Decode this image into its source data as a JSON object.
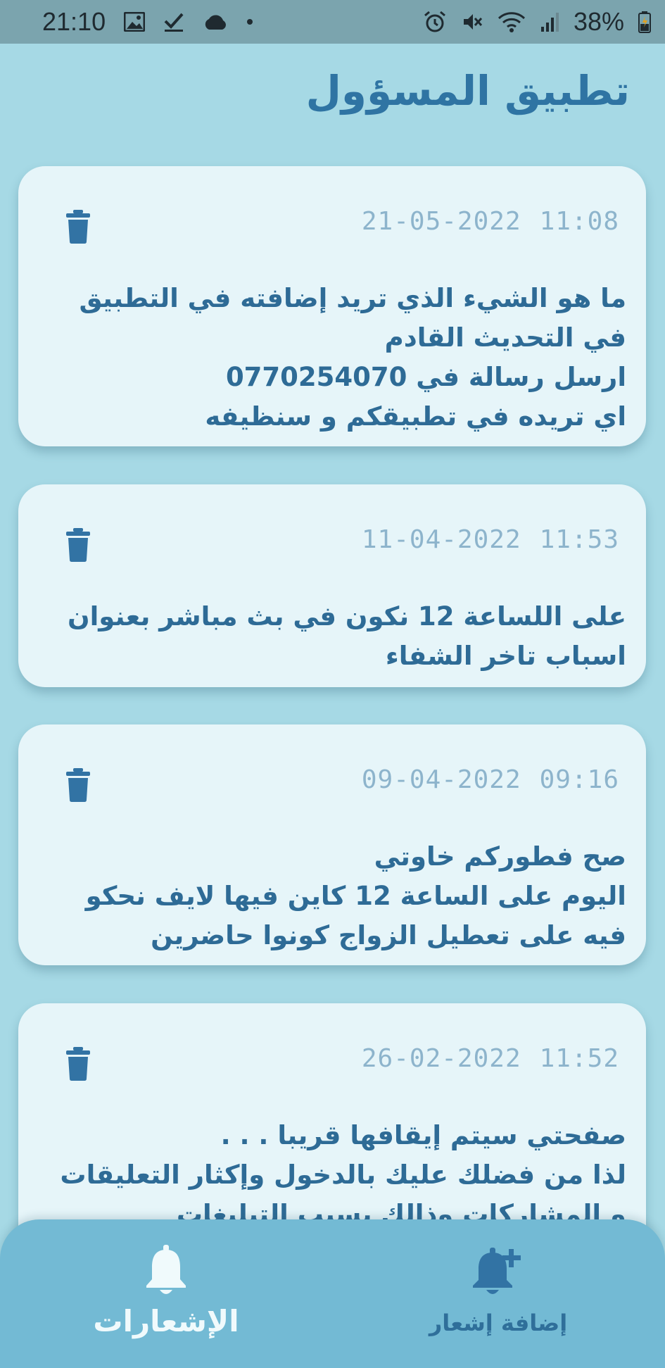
{
  "status_bar": {
    "time": "21:10",
    "battery": "38%",
    "left_icons": [
      "image-icon",
      "checkmark-icon",
      "cloud-icon",
      "dot-icon"
    ],
    "right_icons": [
      "alarm-icon",
      "mute-icon",
      "wifi-icon",
      "signal-icon",
      "battery-icon"
    ]
  },
  "header": {
    "title": "تطبيق المسؤول"
  },
  "notifications": [
    {
      "date": "21-05-2022",
      "time": "11:08",
      "lines": [
        "ما هو الشيء الذي تريد إضافته في التطبيق",
        "في التحديث القادم",
        "ارسل رسالة في 0770254070",
        "اي تريده في تطبيقكم و سنظيفه"
      ]
    },
    {
      "date": "11-04-2022",
      "time": "11:53",
      "lines": [
        "على اللساعة 12 نكون في بث مباشر بعنوان",
        "اسباب تاخر الشفاء"
      ]
    },
    {
      "date": "09-04-2022",
      "time": "09:16",
      "lines": [
        "صح فطوركم خاوتي",
        "اليوم على الساعة 12 كاين فيها لايف نحكو",
        "فيه على تعطيل الزواج كونوا حاضرين"
      ]
    },
    {
      "date": "26-02-2022",
      "time": "11:52",
      "lines": [
        "صفحتي سيتم إيقافها قريبا . . .",
        "لذا من فضلك عليك بالدخول وإكثار التعليقات",
        "و المشاركات وذالك بسبب التبليغات"
      ]
    }
  ],
  "bottom_nav": {
    "add_label": "إضافة إشعار",
    "notifications_label": "الإشعارات",
    "add_icon": "bell-plus-icon",
    "notifications_icon": "bell-icon"
  },
  "colors": {
    "background": "#a6d9e5",
    "card": "#e6f5f9",
    "accent": "#2f74a3",
    "date": "#8db4cc",
    "nav": "#73bad4"
  }
}
